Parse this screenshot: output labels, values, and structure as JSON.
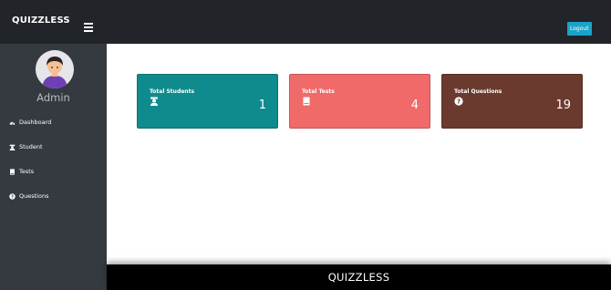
{
  "header": {
    "brand": "QUIZZLESS",
    "logout_label": "Logout"
  },
  "sidebar": {
    "user_name": "Admin",
    "items": [
      {
        "label": "Dashboard",
        "icon": "dashboard-icon"
      },
      {
        "label": "Student",
        "icon": "student-icon"
      },
      {
        "label": "Tests",
        "icon": "book-icon"
      },
      {
        "label": "Questions",
        "icon": "question-circle-icon"
      }
    ]
  },
  "cards": [
    {
      "title": "Total Students",
      "value": "1",
      "color": "#0f8b8d",
      "icon": "student-icon"
    },
    {
      "title": "Total Tests",
      "value": "4",
      "color": "#f06a69",
      "icon": "book-icon"
    },
    {
      "title": "Total Questions",
      "value": "19",
      "color": "#6b3a2e",
      "icon": "question-circle-icon"
    }
  ],
  "footer": {
    "text": "QUIZZLESS"
  },
  "colors": {
    "topbar": "#212428",
    "sidebar": "#343a40",
    "logout": "#1aa3c8"
  }
}
